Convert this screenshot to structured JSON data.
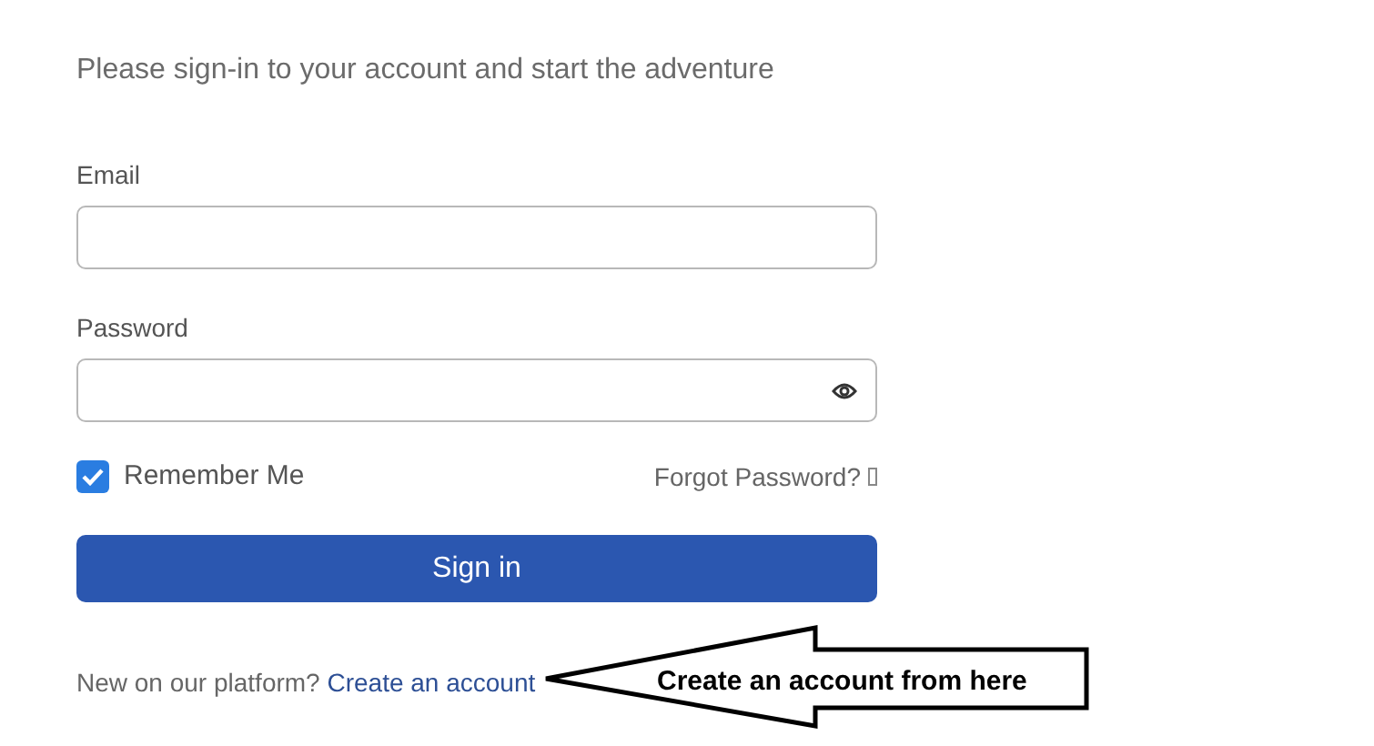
{
  "subtitle": "Please sign-in to your account and start the adventure",
  "email": {
    "label": "Email"
  },
  "password": {
    "label": "Password"
  },
  "remember": {
    "label": "Remember Me",
    "checked": true
  },
  "forgot_link": "Forgot Password?",
  "sign_in_button": "Sign in",
  "footer": {
    "prompt": "New on our platform?",
    "link": "Create an account"
  },
  "callout": {
    "text": "Create an account from here"
  }
}
